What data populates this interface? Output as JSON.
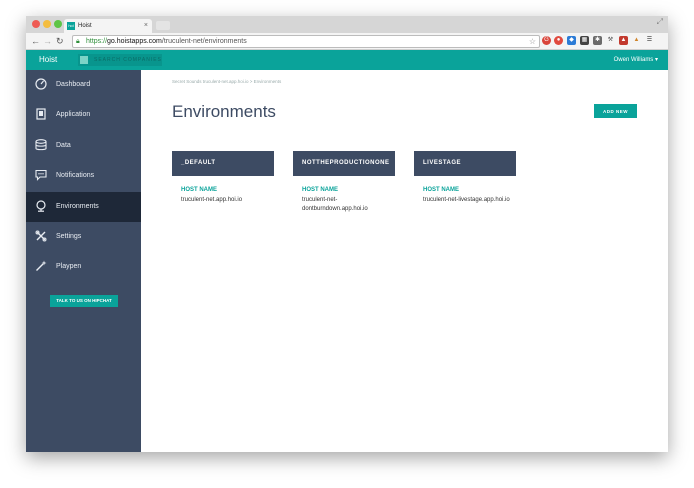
{
  "browser": {
    "tab_title": "Hoist",
    "tab_favicon": "hoi",
    "url_scheme": "https://",
    "url_host": "go.hoistapps.com",
    "url_path": "/truculent-net/environments"
  },
  "header": {
    "brand": "Hoist",
    "app_switch_label": "SEARCH COMPANIES",
    "user_name": "Owen Williams",
    "accent_color": "#0aa39a"
  },
  "sidebar": {
    "items": [
      {
        "label": "Dashboard",
        "icon": "dashboard-icon"
      },
      {
        "label": "Application",
        "icon": "application-icon"
      },
      {
        "label": "Data",
        "icon": "database-icon"
      },
      {
        "label": "Notifications",
        "icon": "chat-bubble-icon"
      },
      {
        "label": "Environments",
        "icon": "globe-icon",
        "active": true
      },
      {
        "label": "Settings",
        "icon": "tools-icon"
      },
      {
        "label": "Playpen",
        "icon": "magic-wand-icon"
      }
    ],
    "hipchat_label": "TALK TO US ON HIPCHAT",
    "background": "#3d4b63",
    "active_background": "#1e2838"
  },
  "main": {
    "breadcrumb": "Secret Sounds truculent-net.app.hoi.io > Environments",
    "title": "Environments",
    "add_button": "ADD NEW",
    "environments": [
      {
        "name": "_DEFAULT",
        "host_label": "HOST NAME",
        "host": "truculent-net.app.hoi.io"
      },
      {
        "name": "NOTTHEPRODUCTIONONE",
        "host_label": "HOST NAME",
        "host": "truculent-net-dontburndown.app.hoi.io"
      },
      {
        "name": "LIVESTAGE",
        "host_label": "HOST NAME",
        "host": "truculent-net-livestage.app.hoi.io"
      }
    ]
  }
}
